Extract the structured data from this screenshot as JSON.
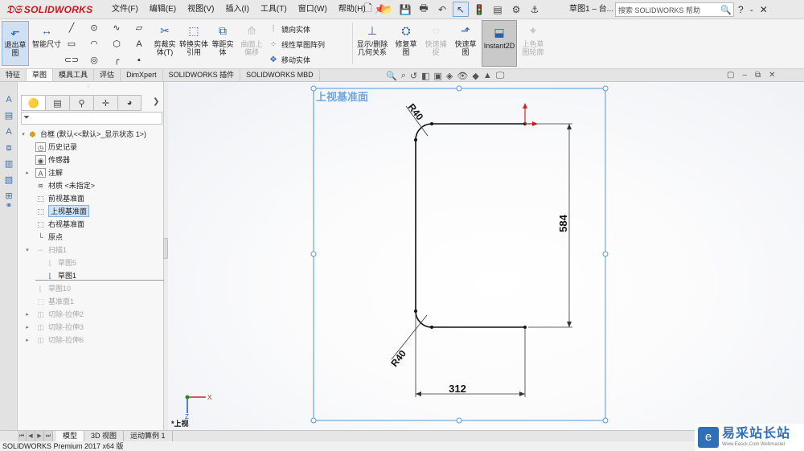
{
  "app": {
    "logo_text": "SOLIDWORKS",
    "title": "草图1 – 台...",
    "brand_color": "#c8161d",
    "accent_color": "#2f6fb8"
  },
  "menu": [
    "文件(F)",
    "编辑(E)",
    "视图(V)",
    "插入(I)",
    "工具(T)",
    "窗口(W)",
    "帮助(H)"
  ],
  "search": {
    "placeholder": "搜索 SOLIDWORKS 帮助"
  },
  "window_controls": [
    "?",
    "-",
    "✕"
  ],
  "ribbon": {
    "exit_sketch": "退出草图",
    "smart_dim": "智能尺寸",
    "trim": "剪裁实体(T)",
    "convert": "转换实体引用",
    "offset": "等距实体",
    "surface_offset": "曲面上偏移",
    "mirror": "镜向实体",
    "linear_pattern": "线性草图阵列",
    "move": "移动实体",
    "show_delete_relations": "显示/删除几何关系",
    "repair": "修复草图",
    "quick_snap": "快速捕捉",
    "rapid_sketch": "快速草图",
    "instant2d": "Instant2D",
    "shaded_contours": "上色草图轮廓"
  },
  "tabs": [
    "特征",
    "草图",
    "模具工具",
    "评估",
    "DimXpert",
    "SOLIDWORKS 插件",
    "SOLIDWORKS MBD"
  ],
  "active_tab": "草图",
  "tree": {
    "root": "台框 (默认<<默认>_显示状态 1>)",
    "items": [
      {
        "label": "历史记录",
        "icon": "history-icon"
      },
      {
        "label": "传感器",
        "icon": "sensor-icon"
      },
      {
        "label": "注解",
        "icon": "annotation-icon"
      },
      {
        "label": "材质 <未指定>",
        "icon": "material-icon"
      },
      {
        "label": "前视基准面",
        "icon": "plane-icon"
      },
      {
        "label": "上视基准面",
        "icon": "plane-icon"
      },
      {
        "label": "右视基准面",
        "icon": "plane-icon"
      },
      {
        "label": "原点",
        "icon": "origin-icon"
      },
      {
        "label": "扫描1",
        "icon": "sweep-icon"
      },
      {
        "label": "草图5",
        "icon": "sketch-icon"
      },
      {
        "label": "草图1",
        "icon": "sketch-icon"
      },
      {
        "label": "草图10",
        "icon": "sketch-icon"
      },
      {
        "label": "基准面1",
        "icon": "plane-icon"
      },
      {
        "label": "切除-拉伸2",
        "icon": "cut-icon"
      },
      {
        "label": "切除-拉伸3",
        "icon": "cut-icon"
      },
      {
        "label": "切除-拉伸6",
        "icon": "cut-icon"
      }
    ]
  },
  "graphics": {
    "plane_label": "上视基准面",
    "dims": {
      "height": "584",
      "width": "312",
      "radius_top": "R40",
      "radius_bottom": "R40"
    },
    "view_label": "*上视",
    "axis_z": "Z",
    "axis_x": "X"
  },
  "bottom_tabs": [
    "模型",
    "3D 视图",
    "运动算例 1"
  ],
  "status": "SOLIDWORKS Premium 2017 x64 版",
  "watermark": {
    "main": "易采站长站",
    "sub": "Www.Easck.Com  Webmaster"
  }
}
